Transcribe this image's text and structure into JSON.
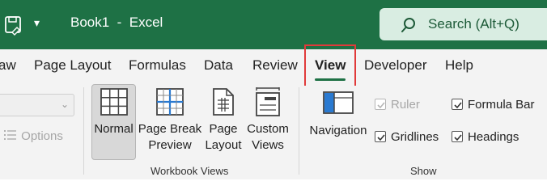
{
  "titlebar": {
    "doc_title": "Book1  -  Excel",
    "quick_access_caret": "▾",
    "search_placeholder": "Search (Alt+Q)",
    "bg_color": "#1e7145"
  },
  "tabs": [
    {
      "label": "aw",
      "active": false
    },
    {
      "label": "Page Layout",
      "active": false
    },
    {
      "label": "Formulas",
      "active": false
    },
    {
      "label": "Data",
      "active": false
    },
    {
      "label": "Review",
      "active": false
    },
    {
      "label": "View",
      "active": true
    },
    {
      "label": "Developer",
      "active": false
    },
    {
      "label": "Help",
      "active": false
    }
  ],
  "ribbon": {
    "options_label": "Options",
    "workbook_views": {
      "group_label": "Workbook Views",
      "normal": "Normal",
      "page_break_line1": "Page Break",
      "page_break_line2": "Preview",
      "page_layout_line1": "Page",
      "page_layout_line2": "Layout",
      "custom_views_line1": "Custom",
      "custom_views_line2": "Views"
    },
    "show": {
      "group_label": "Show",
      "navigation": "Navigation",
      "ruler": "Ruler",
      "gridlines": "Gridlines",
      "formula_bar": "Formula Bar",
      "headings": "Headings",
      "ruler_checked": true,
      "ruler_disabled": true,
      "gridlines_checked": true,
      "formula_bar_checked": true,
      "headings_checked": true
    }
  },
  "accent_color": "#1e7145",
  "highlight_color": "#e03a3a"
}
